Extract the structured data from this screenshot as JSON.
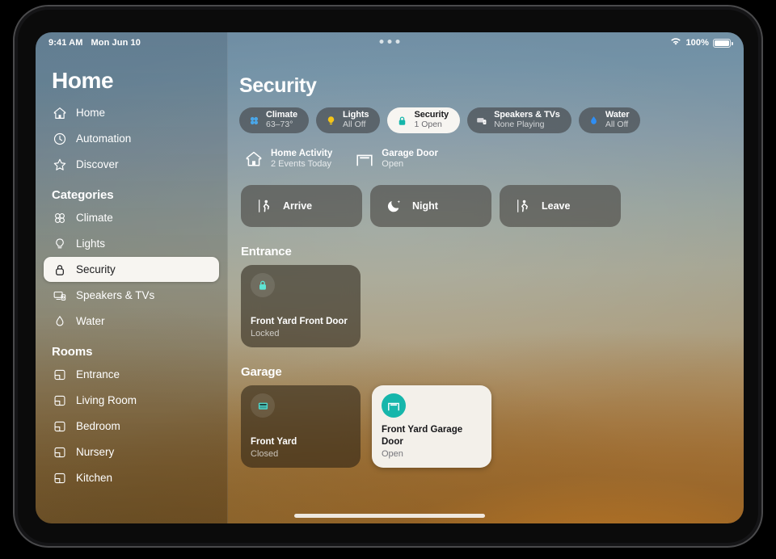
{
  "status_bar": {
    "time": "9:41 AM",
    "date": "Mon Jun 10",
    "battery_percent": "100%",
    "wifi_icon": "wifi-icon",
    "battery_icon": "battery-icon",
    "multitask_icon": "three-dots-icon"
  },
  "sidebar": {
    "title": "Home",
    "top_items": [
      {
        "label": "Home",
        "icon": "house-icon"
      },
      {
        "label": "Automation",
        "icon": "clock-icon"
      },
      {
        "label": "Discover",
        "icon": "star-icon"
      }
    ],
    "categories_header": "Categories",
    "categories": [
      {
        "label": "Climate",
        "icon": "fan-icon",
        "selected": false
      },
      {
        "label": "Lights",
        "icon": "bulb-icon",
        "selected": false
      },
      {
        "label": "Security",
        "icon": "lock-icon",
        "selected": true
      },
      {
        "label": "Speakers & TVs",
        "icon": "speaker-tv-icon",
        "selected": false
      },
      {
        "label": "Water",
        "icon": "droplet-icon",
        "selected": false
      }
    ],
    "rooms_header": "Rooms",
    "rooms": [
      {
        "label": "Entrance",
        "icon": "room-icon"
      },
      {
        "label": "Living Room",
        "icon": "room-icon"
      },
      {
        "label": "Bedroom",
        "icon": "room-icon"
      },
      {
        "label": "Nursery",
        "icon": "room-icon"
      },
      {
        "label": "Kitchen",
        "icon": "room-icon"
      }
    ]
  },
  "main": {
    "page_title": "Security",
    "status_pills": [
      {
        "name": "Climate",
        "sub": "63–73°",
        "icon": "fan-icon",
        "color": "#4aa6e8",
        "active": false
      },
      {
        "name": "Lights",
        "sub": "All Off",
        "icon": "bulb-icon",
        "color": "#f5c518",
        "active": false
      },
      {
        "name": "Security",
        "sub": "1 Open",
        "icon": "lock-icon",
        "color": "#16b6ab",
        "active": true
      },
      {
        "name": "Speakers & TVs",
        "sub": "None Playing",
        "icon": "speaker-tv-icon",
        "color": "#d8d8dc",
        "active": false
      },
      {
        "name": "Water",
        "sub": "All Off",
        "icon": "droplet-icon",
        "color": "#2f8ef4",
        "active": false
      }
    ],
    "summaries": [
      {
        "name": "Home Activity",
        "sub": "2 Events Today",
        "icon": "house-icon"
      },
      {
        "name": "Garage Door",
        "sub": "Open",
        "icon": "garage-icon"
      }
    ],
    "scenes": [
      {
        "label": "Arrive",
        "icon": "person-arrive-icon"
      },
      {
        "label": "Night",
        "icon": "moon-icon"
      },
      {
        "label": "Leave",
        "icon": "person-leave-icon"
      }
    ],
    "sections": [
      {
        "title": "Entrance",
        "cards": [
          {
            "name": "Front Yard Front Door",
            "state": "Locked",
            "icon": "lock-icon",
            "active": false,
            "accent": "#5ee3d4"
          }
        ]
      },
      {
        "title": "Garage",
        "cards": [
          {
            "name": "Front Yard",
            "state": "Closed",
            "icon": "garage-closed-icon",
            "active": false,
            "accent": "#4fd8cc"
          },
          {
            "name": "Front Yard Garage Door",
            "state": "Open",
            "icon": "garage-open-icon",
            "active": true,
            "accent": "#16b6ab"
          }
        ]
      }
    ]
  },
  "home_indicator": "home-indicator"
}
